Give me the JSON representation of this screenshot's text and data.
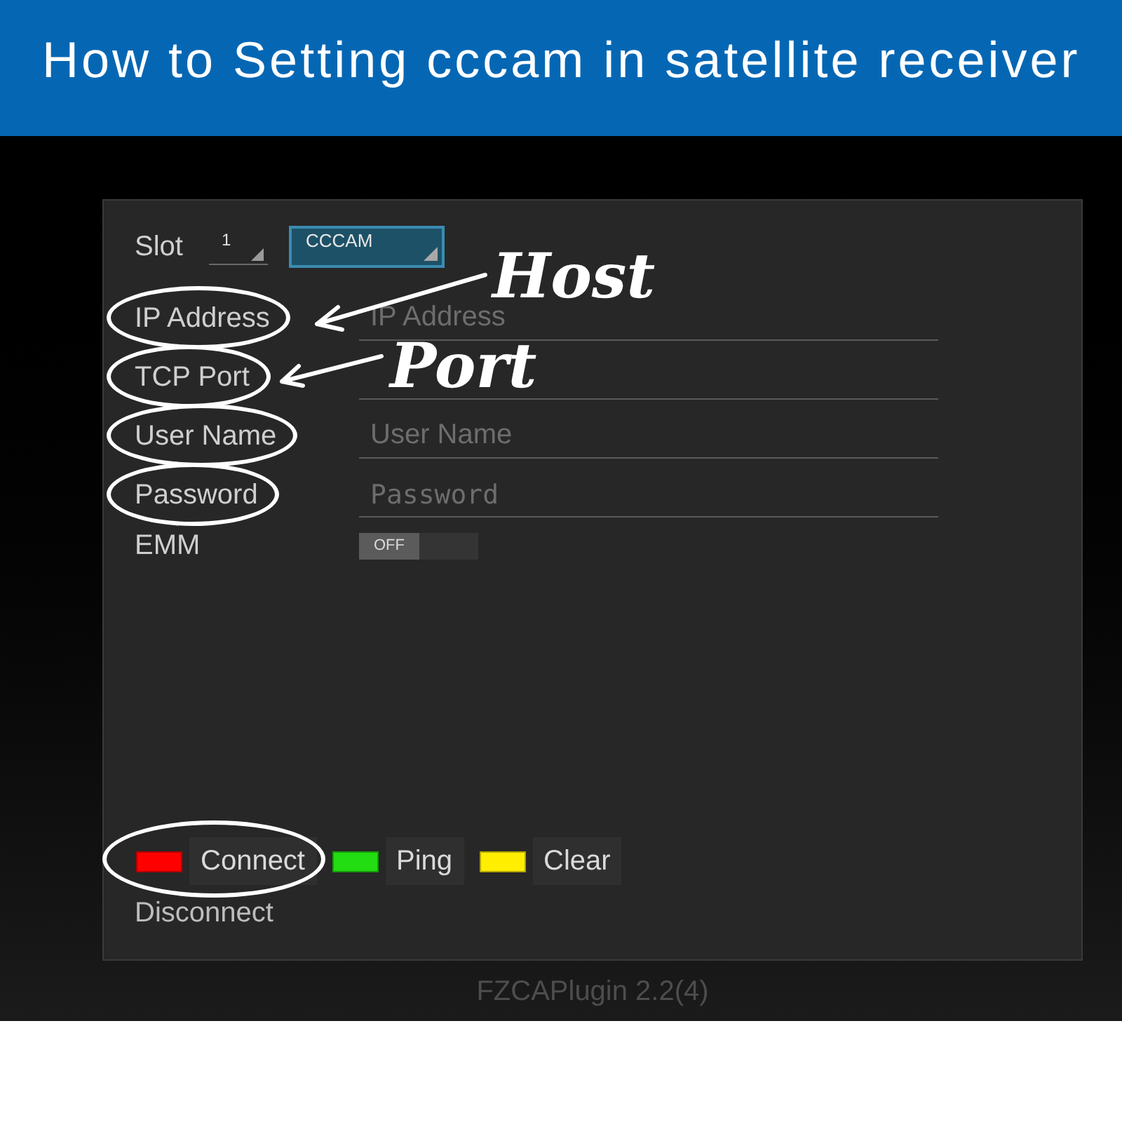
{
  "banner": {
    "title": "How to Setting cccam in satellite receiver"
  },
  "panel": {
    "slot": {
      "label": "Slot",
      "value": "1",
      "protocol": {
        "text": "CCCAM",
        "focused": true
      }
    },
    "fields": [
      {
        "kind": "text",
        "label": "IP Address",
        "placeholder": "IP Address",
        "circled": true,
        "callout": "Host"
      },
      {
        "kind": "text",
        "label": "TCP Port",
        "circled": true,
        "callout": "Port"
      },
      {
        "kind": "text",
        "label": "User Name",
        "placeholder": "User Name",
        "circled": true
      },
      {
        "kind": "password",
        "label": "Password",
        "placeholder": "Password",
        "circled": true
      },
      {
        "kind": "toggle",
        "label": "EMM",
        "on": false,
        "state_text": "OFF",
        "circled": false
      }
    ],
    "buttons": [
      {
        "label": "Connect",
        "color": "#ff0000",
        "circled": true
      },
      {
        "label": "Ping",
        "color": "#22dd11",
        "circled": false
      },
      {
        "label": "Clear",
        "color": "#ffee00",
        "circled": false
      }
    ],
    "status": "Disconnect"
  },
  "footer": "FZCAPlugin 2.2(4)"
}
